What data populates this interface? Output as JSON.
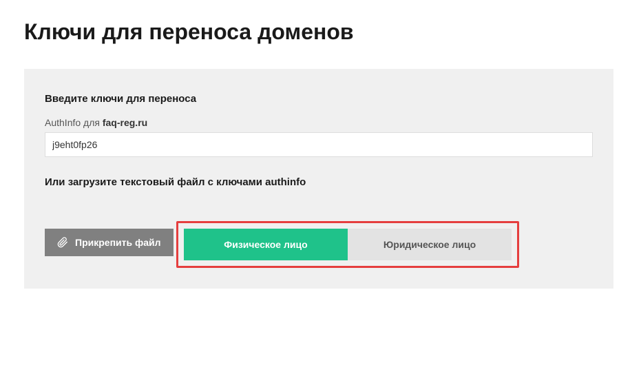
{
  "page": {
    "title": "Ключи для переноса доменов"
  },
  "panel": {
    "enter_keys_heading": "Введите ключи для переноса",
    "authinfo_label_prefix": "AuthInfo для ",
    "authinfo_domain": "faq-reg.ru",
    "authinfo_value": "j9eht0fp26",
    "upload_heading": "Или загрузите текстовый файл с ключами authinfo",
    "attach_button_label": "Прикрепить файл",
    "entity_toggle": {
      "individual": "Физическое лицо",
      "legal": "Юридическое лицо",
      "active": "individual"
    }
  }
}
